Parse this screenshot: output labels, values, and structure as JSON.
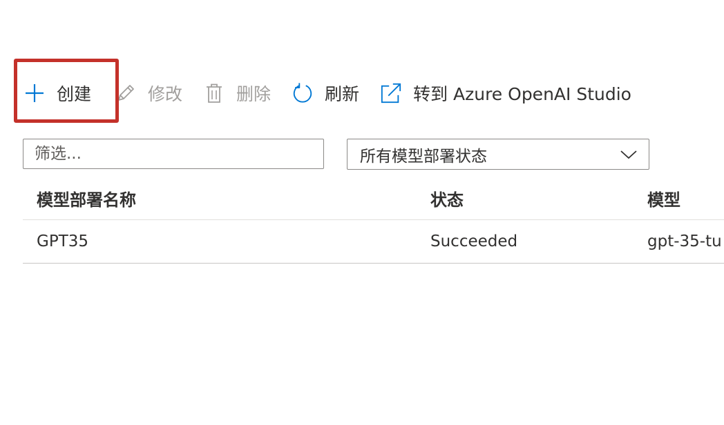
{
  "toolbar": {
    "create": {
      "label": "创建",
      "icon": "plus-icon",
      "enabled": true
    },
    "edit": {
      "label": "修改",
      "icon": "pencil-icon",
      "enabled": false
    },
    "delete": {
      "label": "删除",
      "icon": "trash-icon",
      "enabled": false
    },
    "refresh": {
      "label": "刷新",
      "icon": "refresh-icon",
      "enabled": true
    },
    "open_studio": {
      "label": "转到 Azure OpenAI Studio",
      "icon": "external-link-icon",
      "enabled": true
    }
  },
  "filters": {
    "search": {
      "placeholder": "筛选...",
      "value": ""
    },
    "status": {
      "selected": "所有模型部署状态",
      "icon": "chevron-down-icon"
    }
  },
  "table": {
    "columns": [
      "模型部署名称",
      "状态",
      "模型"
    ],
    "rows": [
      {
        "name": "GPT35",
        "status": "Succeeded",
        "model": "gpt-35-tu"
      }
    ]
  },
  "colors": {
    "accent": "#0078d4",
    "highlight": "#c4312a",
    "disabled_text": "#a19f9d",
    "text": "#323130"
  }
}
